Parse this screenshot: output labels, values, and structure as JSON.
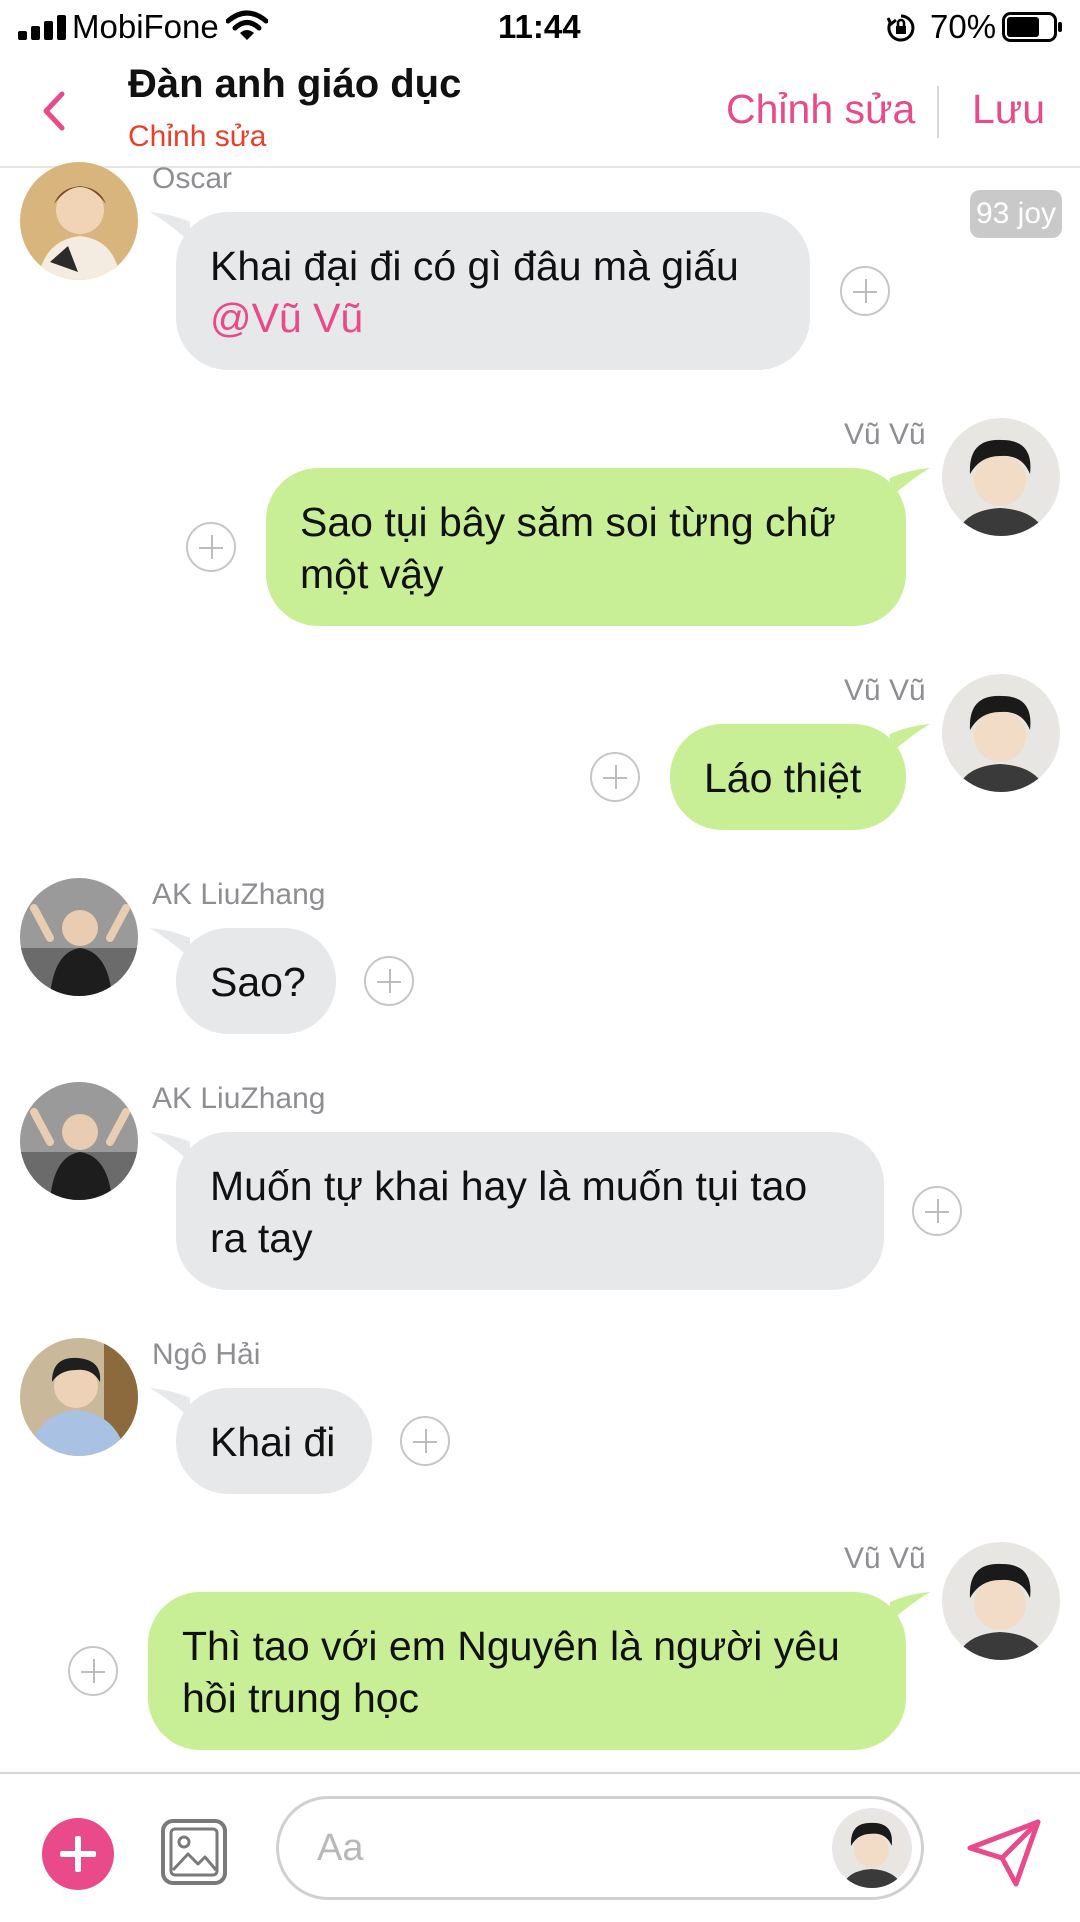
{
  "status_bar": {
    "carrier": "MobiFone",
    "time": "11:44",
    "battery": "70%",
    "battery_level": 0.7
  },
  "header": {
    "title": "Đàn anh giáo dục",
    "subtitle": "Chỉnh sửa",
    "edit_label": "Chỉnh sửa",
    "save_label": "Lưu"
  },
  "badge": "93 joy",
  "messages": [
    {
      "sender": "Oscar",
      "side": "in",
      "line1": "Khai đại đi có gì đâu mà giấu",
      "mention": "@Vũ Vũ"
    },
    {
      "sender": "Vũ Vũ",
      "side": "out",
      "line1": "Sao tụi bây săm soi từng chữ",
      "line2": "một vậy"
    },
    {
      "sender": "Vũ Vũ",
      "side": "out",
      "line1": "Láo thiệt"
    },
    {
      "sender": "AK LiuZhang",
      "side": "in",
      "line1": "Sao?"
    },
    {
      "sender": "AK LiuZhang",
      "side": "in",
      "line1": "Muốn tự khai hay là muốn tụi tao",
      "line2": "ra tay"
    },
    {
      "sender": "Ngô Hải",
      "side": "in",
      "line1": "Khai đi"
    },
    {
      "sender": "Vũ Vũ",
      "side": "out",
      "line1": "Thì tao với em Nguyên là người yêu",
      "line2": "hồi trung học"
    }
  ],
  "composer": {
    "placeholder": "Aa"
  },
  "colors": {
    "accent": "#e94a8a",
    "subtitle_red": "#e8402b",
    "incoming_bubble": "#e7e8ea",
    "outgoing_bubble": "#c9ef96"
  },
  "icons": {
    "back": "chevron-left-icon",
    "add": "plus-icon",
    "image": "image-icon",
    "send": "send-icon",
    "reaction": "add-reaction-icon"
  }
}
